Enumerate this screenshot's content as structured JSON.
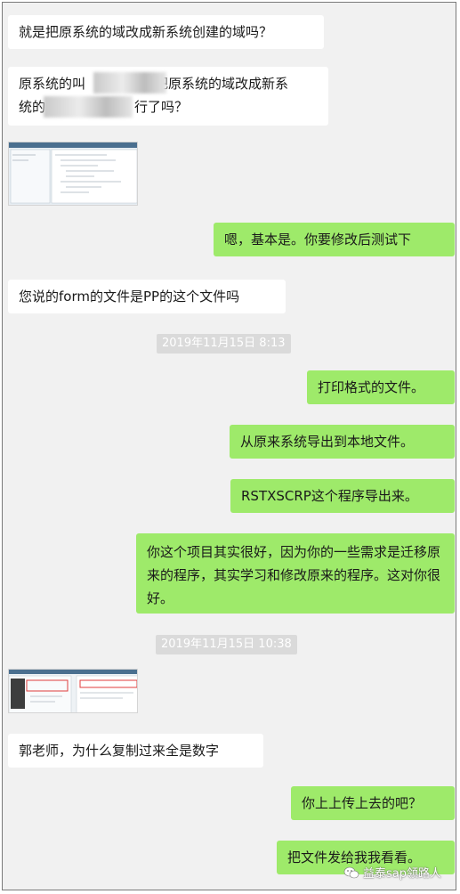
{
  "messages": {
    "m1": "就是把原系统的域改成新系统创建的域吗？",
    "m2_line1": "原系统的叫",
    "m2_line1b": "把原系统的域改成新系",
    "m2_line2": "统的",
    "m2_line2b": "行了吗？",
    "m3": "嗯，基本是。你要修改后测试下",
    "m4": "您说的form的文件是PP的这个文件吗",
    "ts1": "2019年11月15日 8:13",
    "m5": "打印格式的文件。",
    "m6": "从原来系统导出到本地文件。",
    "m7": "RSTXSCRP这个程序导出来。",
    "m8": "你这个项目其实很好，因为你的一些需求是迁移原来的程序，其实学习和修改原来的程序。这对你很好。",
    "ts2": "2019年11月15日 10:38",
    "m9": "郭老师，为什么复制过来全是数字",
    "m10": "你上上传上去的吧？",
    "m11": "把文件发给我我看看。"
  },
  "watermark": {
    "text": "益泰sap领路人",
    "icon": "wechat-icon"
  },
  "colors": {
    "sent_bubble": "#9eea6a",
    "received_bubble": "#ffffff",
    "background": "#f1f1f1",
    "timestamp_bg": "#dadada"
  }
}
